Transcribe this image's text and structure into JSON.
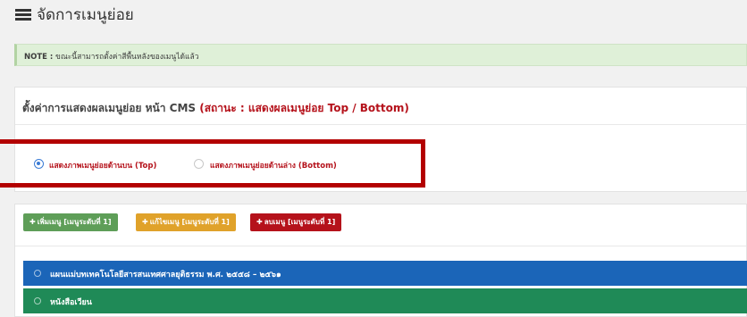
{
  "header": {
    "title": "จัดการเมนูย่อย",
    "icon": "list-icon"
  },
  "note": {
    "label": "NOTE :",
    "text": "ขณะนี้สามารถตั้งค่าสีพื้นหลังของเมนูได้แล้ว"
  },
  "settings": {
    "title": "ตั้งค่าการแสดงผลเมนูย่อย หน้า CMS",
    "status": "(สถานะ : แสดงผลเมนูย่อย Top / Bottom)",
    "options": [
      {
        "label": "แสดงภาพเมนูย่อยด้านบน (Top)",
        "checked": true
      },
      {
        "label": "แสดงภาพเมนูย่อยด้านล่าง (Bottom)",
        "checked": false
      }
    ]
  },
  "toolbar": {
    "add_label": "เพิ่มเมนู [เมนูระดับที่ 1]",
    "edit_label": "แก้ไขเมนู [เมนูระดับที่ 1]",
    "delete_label": "ลบเมนู [เมนูระดับที่ 1]"
  },
  "menu_items": [
    {
      "label": "แผนแม่บทเทคโนโลยีสารสนเทศศาลยุติธรรม พ.ศ. ๒๕๕๘ – ๒๕๖๑",
      "color": "#1b65b8"
    },
    {
      "label": "หนังสือเวียน",
      "color": "#1f8a57"
    }
  ],
  "colors": {
    "accent_red": "#b5121b",
    "add_green": "#5e9e58",
    "edit_orange": "#e0a22a",
    "note_bg": "#dff0d8"
  }
}
